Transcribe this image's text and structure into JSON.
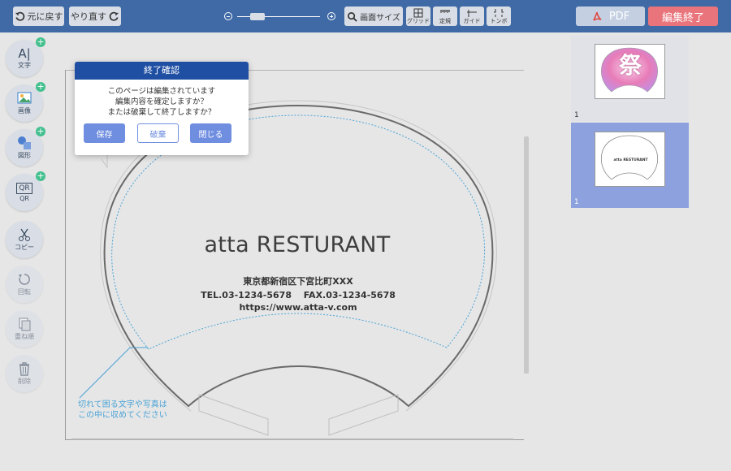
{
  "toolbar": {
    "undo_label": "元に戻す",
    "redo_label": "やり直す",
    "fit_screen_label": "画面サイズ",
    "grid_label": "グリッド",
    "ruler_label": "定規",
    "guide_label": "ガイド",
    "trim_label": "トンボ",
    "pdf_label": "PDF",
    "finish_label": "編集終了"
  },
  "tools": [
    {
      "label": "文字",
      "glyph": "A|"
    },
    {
      "label": "画像"
    },
    {
      "label": "図形"
    },
    {
      "label": "QR",
      "glyph": "QR"
    },
    {
      "label": "コピー"
    },
    {
      "label": "回転"
    },
    {
      "label": "重ね順"
    },
    {
      "label": "削除"
    }
  ],
  "dialog": {
    "title": "終了確認",
    "message_line1": "このページは編集されています",
    "message_line2": "編集内容を確定しますか？",
    "message_line3": "または破棄して終了しますか？",
    "save_label": "保存",
    "discard_label": "破棄",
    "close_label": "閉じる"
  },
  "design": {
    "shop_name": "atta RESTURANT",
    "address": "東京都新宿区下宮比町XXX",
    "phone_fax": "TEL.03-1234-5678　 FAX.03-1234-5678",
    "url": "https://www.atta-v.com",
    "safe_area_note_line1": "切れて困る文字や写真は",
    "safe_area_note_line2": "この中に収めてください"
  },
  "pages": [
    {
      "number": "1",
      "thumbnail_text": "祭",
      "selected": false
    },
    {
      "number": "1",
      "thumbnail_text": "atta RESTURANT",
      "selected": true
    }
  ],
  "colors": {
    "toolbar": "#3f6aa6",
    "finish_button": "#e9747c",
    "dialog_header": "#1f4fa3",
    "dialog_button": "#6f8ee0",
    "selected_thumbnail": "#8ca1dd",
    "safe_area_line": "#4aa3d6",
    "add_badge": "#43c08e"
  }
}
